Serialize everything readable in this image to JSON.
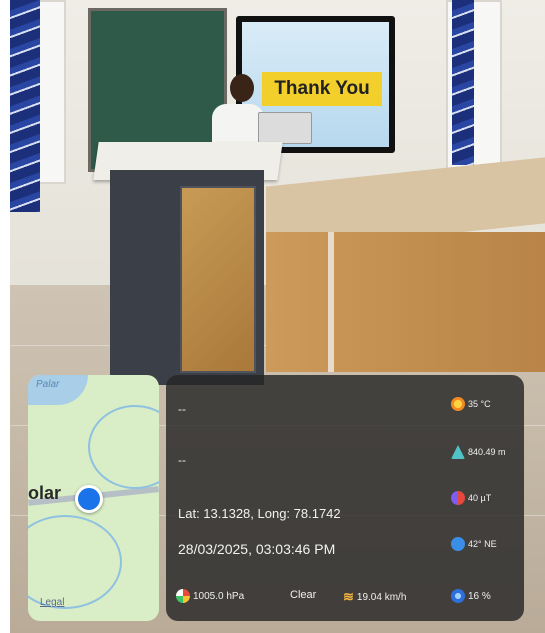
{
  "scene": {
    "screen_text": "Thank You"
  },
  "map": {
    "water_label": "Palar",
    "town_label": "olar",
    "legal_link": "Legal"
  },
  "panel": {
    "line1": "--",
    "line2": "--",
    "coordinates": "Lat: 13.1328, Long: 78.1742",
    "datetime": "28/03/2025, 03:03:46 PM",
    "temperature": "35 °C",
    "altitude": "840.49 m",
    "magnetic": "40 µT",
    "wind_direction": "42° NE",
    "pressure": "1005.0 hPa",
    "condition": "Clear",
    "wind_speed": "19.04 km/h",
    "humidity": "16 %"
  },
  "colors": {
    "map_pin": "#1a73e8",
    "panel_bg": "#262626"
  },
  "icons": [
    "thermometer-sun-icon",
    "mountain-icon",
    "magnet-icon",
    "compass-icon",
    "pressure-gauge-icon",
    "wind-icon",
    "humidity-drop-icon",
    "location-pin-icon"
  ]
}
